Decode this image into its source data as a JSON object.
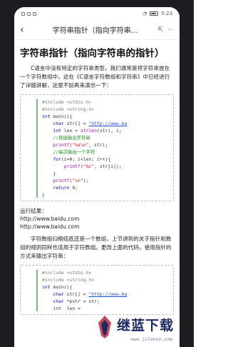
{
  "status": {
    "time": "5:23"
  },
  "appbar": {
    "title": "字符串指针（指向字符串…",
    "back_icon": "‹",
    "share_icon": "⇱",
    "more_icon": "⋯"
  },
  "article": {
    "heading": "字符串指针（指向字符串的指针）",
    "intro": "C语言中没有特定的字符串类型，我们通常是将字符串放在一个字符数组中，这在《C语言字符数组和字符串》中已经进行了详细讲解，这里不妨再来演示一下：",
    "code1": {
      "l1": "#include <stdio.h>",
      "l2": "#include <string.h>",
      "l3a": "int",
      "l3b": " main(){",
      "l4a": "    char",
      "l4b": " str[] = ",
      "l4c": "\"http://www.ba",
      "l5a": "    int",
      "l5b": " len = ",
      "l5c": "strlen",
      "l5d": "(str), i;",
      "l6": "    //直接输出字符串",
      "l7a": "    printf",
      "l7b": "(\"%s\\n\"",
      "l7c": ", str);",
      "l8": "    //每次输出一个字符",
      "l9a": "    for",
      "l9b": "(i=0; i<len; i++){",
      "l10a": "        printf",
      "l10b": "(\"%c\"",
      "l10c": ", str[i]);",
      "l11": "    }",
      "l12a": "    printf",
      "l12b": "(\"\\n\"",
      "l12c": ");",
      "l13a": "    return",
      "l13b": " 0;",
      "l14": "}"
    },
    "result_label": "运行结果：",
    "result_line1": "http://www.baidu.com",
    "result_line2": "http://www.baidu.com",
    "para2": "字符数组归根结底还是一个数组，上节讲到的关于指针和数组的规则同样也适用于字符数组。更改上面的代码，使用指针的方式来输出字符串：",
    "code2": {
      "l1": "#include <stdio.h>",
      "l2": "#include <string.h>",
      "l3a": "int",
      "l3b": " main(){",
      "l4a": "    char",
      "l4b": " str[] = ",
      "l4c": "\"http://www.ba",
      "l5a": "    char",
      "l5b": " *pstr = str;",
      "l6": "    int  len ="
    }
  },
  "watermark": {
    "text": "继蓝下载",
    "url": "www.jilanxz.com"
  }
}
